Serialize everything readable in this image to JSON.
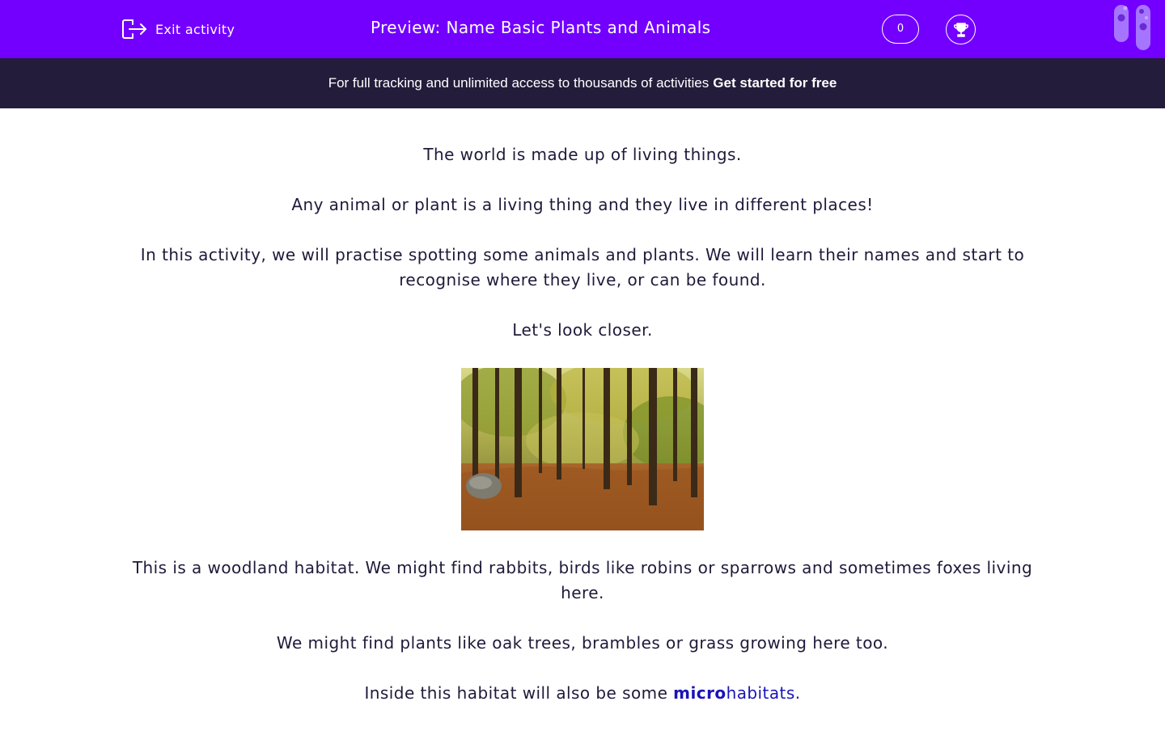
{
  "header": {
    "exit_label": "Exit activity",
    "title": "Preview: Name Basic Plants and Animals",
    "score": "0",
    "brand_color": "#7300ff"
  },
  "banner": {
    "text": "For full tracking and unlimited access to thousands of activities",
    "cta": "Get started for free"
  },
  "content": {
    "p1": "The world is made up of living things.",
    "p2": "Any animal or plant is a living thing and they live in different places!",
    "p3": "In this activity, we will practise spotting some animals and plants. We will learn their names and start to recognise where they live, or can be found.",
    "p4": "Let's look closer.",
    "p5": "This is a woodland habitat. We might find rabbits, birds like robins or sparrows and sometimes foxes living here.",
    "p6": "We might find plants like oak trees, brambles or grass growing here too.",
    "p7_prefix": "Inside this habitat will also be some ",
    "p7_bold": "micro",
    "p7_rest": "habitats."
  },
  "icons": {
    "exit": "exit-icon",
    "trophy": "trophy-icon",
    "decor": "test-tubes-icon"
  }
}
